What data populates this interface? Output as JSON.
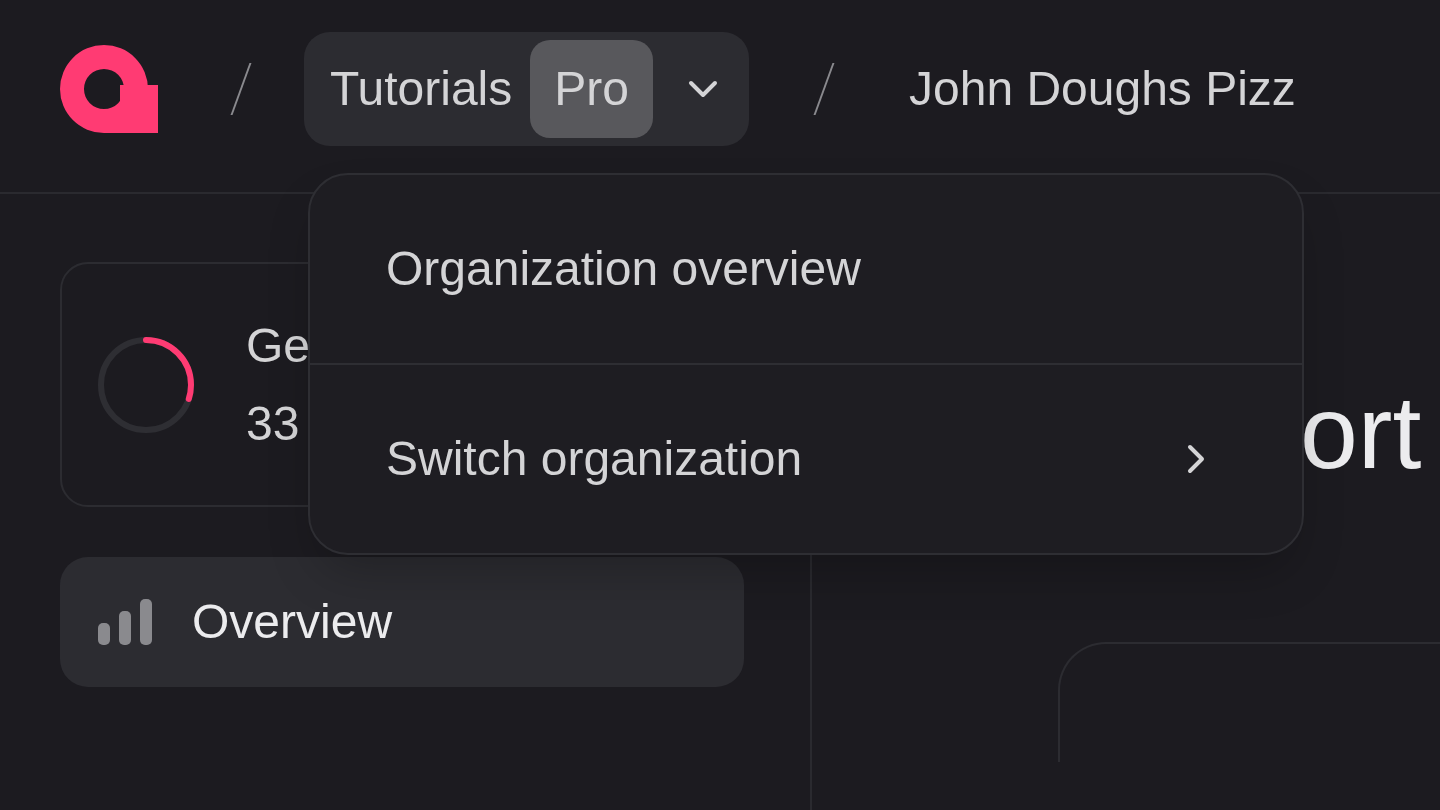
{
  "breadcrumb": {
    "organization": {
      "name": "Tutorials",
      "badge": "Pro",
      "expanded": true
    },
    "project": "John Doughs Pizz"
  },
  "setup_card": {
    "title": "Ge",
    "count": "33",
    "level": 0.3
  },
  "nav": [
    {
      "label": "Overview",
      "selected": true
    }
  ],
  "main": {
    "heading": "ort"
  },
  "menu": [
    {
      "label": "Organization overview",
      "submenu": false
    },
    {
      "label": "Switch organization",
      "submenu": true
    }
  ]
}
